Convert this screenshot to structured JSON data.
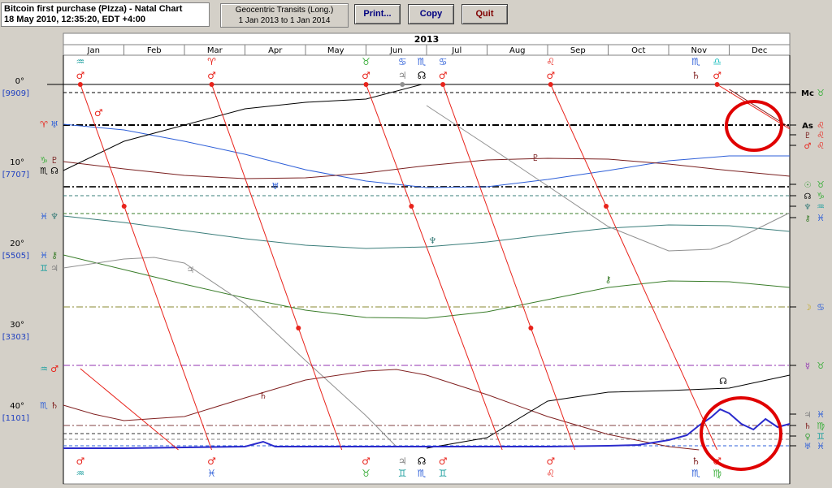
{
  "header": {
    "line1": "Bitcoin first purchase (PIzza) - Natal Chart",
    "line2": "18 May 2010, 12:35:20, EDT +4:00"
  },
  "range": {
    "line1": "Geocentric Transits (Long.)",
    "line2": "1 Jan 2013 to 1 Jan 2014"
  },
  "toolbar": {
    "print": "Print...",
    "copy": "Copy",
    "quit": "Quit"
  },
  "nav": {
    "prev": "<<",
    "next": ">>"
  },
  "colors": {
    "mars": "#e8231b",
    "saturn": "#802020",
    "jupiter": "#909090",
    "uranus": "#2e5fd8",
    "neptune": "#3a7d7a",
    "chiron": "#3a7d2a",
    "pluto": "#7a2020",
    "node": "#000000",
    "price": "#2a2acc",
    "circle": "#e00000"
  },
  "chart_data": {
    "type": "line",
    "title": "2013",
    "months": [
      "Jan",
      "Feb",
      "Mar",
      "Apr",
      "May",
      "Jun",
      "Jul",
      "Aug",
      "Sep",
      "Oct",
      "Nov",
      "Dec"
    ],
    "yticks": [
      {
        "deg": 0,
        "label": "0°",
        "price": "[9909]"
      },
      {
        "deg": 10,
        "label": "10°",
        "price": "[7707]"
      },
      {
        "deg": 20,
        "label": "20°",
        "price": "[5505]"
      },
      {
        "deg": 30,
        "label": "30°",
        "price": "[3303]"
      },
      {
        "deg": 40,
        "label": "40°",
        "price": "[1101]"
      }
    ],
    "ylim": [
      0,
      45
    ],
    "xlim": [
      0,
      12
    ],
    "glyph_sign_top": [
      {
        "x": 0.28,
        "sym": "♒",
        "color": "#20a0a0"
      },
      {
        "x": 2.45,
        "sym": "♈",
        "color": "#e8231b"
      },
      {
        "x": 5.0,
        "sym": "♉",
        "color": "#40b040"
      },
      {
        "x": 5.6,
        "sym": "♋",
        "color": "#2e5fd8"
      },
      {
        "x": 5.92,
        "sym": "♏",
        "color": "#2e5fd8"
      },
      {
        "x": 6.27,
        "sym": "♋",
        "color": "#2e5fd8"
      },
      {
        "x": 8.05,
        "sym": "♌",
        "color": "#e8231b"
      },
      {
        "x": 10.45,
        "sym": "♏",
        "color": "#2e5fd8"
      },
      {
        "x": 10.8,
        "sym": "♎",
        "color": "#20c0c0"
      }
    ],
    "glyph_planet_top": [
      {
        "x": 0.28,
        "sym": "♂",
        "color": "#e8231b"
      },
      {
        "x": 2.45,
        "sym": "♂",
        "color": "#e8231b"
      },
      {
        "x": 5.0,
        "sym": "♂",
        "color": "#e8231b"
      },
      {
        "x": 5.6,
        "sym": "♃",
        "color": "#808080"
      },
      {
        "x": 5.92,
        "sym": "☊",
        "color": "#000000"
      },
      {
        "x": 6.27,
        "sym": "♂",
        "color": "#e8231b"
      },
      {
        "x": 8.05,
        "sym": "♂",
        "color": "#e8231b"
      },
      {
        "x": 10.45,
        "sym": "♄",
        "color": "#802020"
      },
      {
        "x": 10.8,
        "sym": "♂",
        "color": "#e8231b"
      }
    ],
    "glyph_planet_bottom": [
      {
        "x": 0.28,
        "sym": "♂",
        "color": "#e8231b"
      },
      {
        "x": 2.45,
        "sym": "♂",
        "color": "#e8231b"
      },
      {
        "x": 5.0,
        "sym": "♂",
        "color": "#e8231b"
      },
      {
        "x": 5.6,
        "sym": "♃",
        "color": "#808080"
      },
      {
        "x": 5.92,
        "sym": "☊",
        "color": "#000000"
      },
      {
        "x": 6.27,
        "sym": "♂",
        "color": "#e8231b"
      },
      {
        "x": 8.05,
        "sym": "♂",
        "color": "#e8231b"
      },
      {
        "x": 10.45,
        "sym": "♄",
        "color": "#802020"
      },
      {
        "x": 10.8,
        "sym": "♂",
        "color": "#e8231b"
      }
    ],
    "glyph_sign_bottom": [
      {
        "x": 0.28,
        "sym": "♒",
        "color": "#20a0a0"
      },
      {
        "x": 2.45,
        "sym": "♓",
        "color": "#2e5fd8"
      },
      {
        "x": 5.0,
        "sym": "♉",
        "color": "#40b040"
      },
      {
        "x": 5.6,
        "sym": "♊",
        "color": "#20a0a0"
      },
      {
        "x": 5.92,
        "sym": "♏",
        "color": "#2e5fd8"
      },
      {
        "x": 6.27,
        "sym": "♊",
        "color": "#20a0a0"
      },
      {
        "x": 8.05,
        "sym": "♌",
        "color": "#e8231b"
      },
      {
        "x": 10.45,
        "sym": "♏",
        "color": "#2e5fd8"
      },
      {
        "x": 10.8,
        "sym": "♍",
        "color": "#40b040"
      }
    ],
    "left_glyphs": [
      {
        "deg": 4.9,
        "sign": "♈",
        "sc": "#e8231b",
        "planet": "♅",
        "pc": "#2e5fd8"
      },
      {
        "deg": 9.3,
        "sign": "♑",
        "sc": "#40b040",
        "planet": "♇",
        "pc": "#7a2020"
      },
      {
        "deg": 10.6,
        "sign": "♏",
        "sc": "#000000",
        "planet": "☊",
        "pc": "#000000"
      },
      {
        "deg": 16.2,
        "sign": "♓",
        "sc": "#2e5fd8",
        "planet": "♆",
        "pc": "#3a7d7a"
      },
      {
        "deg": 21.0,
        "sign": "♓",
        "sc": "#2e5fd8",
        "planet": "⚷",
        "pc": "#3a7d2a"
      },
      {
        "deg": 22.6,
        "sign": "♊",
        "sc": "#20a0a0",
        "planet": "♃",
        "pc": "#808080"
      },
      {
        "deg": 35.0,
        "sign": "♒",
        "sc": "#20a0a0",
        "planet": "♂",
        "pc": "#e8231b"
      },
      {
        "deg": 39.5,
        "sign": "♏",
        "sc": "#2e5fd8",
        "planet": "♄",
        "pc": "#802020"
      }
    ],
    "right_glyphs": [
      {
        "deg": 1.0,
        "planet": "Mc",
        "pc": "#000000",
        "sign": "♉",
        "sc": "#40b040"
      },
      {
        "deg": 5.0,
        "planet": "As",
        "pc": "#000000",
        "sign": "♌",
        "sc": "#e8231b"
      },
      {
        "deg": 6.2,
        "planet": "♇",
        "pc": "#7a2020",
        "sign": "♌",
        "sc": "#e8231b"
      },
      {
        "deg": 7.5,
        "planet": "♂",
        "pc": "#e8231b",
        "sign": "♌",
        "sc": "#e8231b"
      },
      {
        "deg": 12.3,
        "planet": "☉",
        "pc": "#40a040",
        "sign": "♉",
        "sc": "#40b040"
      },
      {
        "deg": 13.7,
        "planet": "☊",
        "pc": "#000000",
        "sign": "♑",
        "sc": "#40b040"
      },
      {
        "deg": 15.0,
        "planet": "♆",
        "pc": "#3a7d7a",
        "sign": "♒",
        "sc": "#20a0a0"
      },
      {
        "deg": 16.4,
        "planet": "⚷",
        "pc": "#3a7d2a",
        "sign": "♓",
        "sc": "#2e5fd8"
      },
      {
        "deg": 27.4,
        "planet": "☽",
        "pc": "#c0a000",
        "sign": "♋",
        "sc": "#2e5fd8"
      },
      {
        "deg": 34.6,
        "planet": "☿",
        "pc": "#9030b0",
        "sign": "♉",
        "sc": "#40b040"
      },
      {
        "deg": 40.6,
        "planet": "♃",
        "pc": "#808080",
        "sign": "♓",
        "sc": "#2e5fd8"
      },
      {
        "deg": 42.0,
        "planet": "♄",
        "pc": "#802020",
        "sign": "♍",
        "sc": "#40b040"
      },
      {
        "deg": 43.3,
        "planet": "♀",
        "pc": "#40a040",
        "sign": "♊",
        "sc": "#20a0a0"
      },
      {
        "deg": 44.5,
        "planet": "♅",
        "pc": "#2e5fd8",
        "sign": "♓",
        "sc": "#2e5fd8"
      }
    ],
    "natal_lines": [
      {
        "deg": 1.0,
        "color": "#000000",
        "style": "dash"
      },
      {
        "deg": 5.0,
        "color": "#000000",
        "style": "dashdot-bold"
      },
      {
        "deg": 12.6,
        "color": "#303030",
        "style": "dashdot-bold"
      },
      {
        "deg": 13.7,
        "color": "#3a7d7a",
        "style": "dash"
      },
      {
        "deg": 15.9,
        "color": "#3a7d2a",
        "style": "dash"
      },
      {
        "deg": 27.4,
        "color": "#8a8a30",
        "style": "dashdot"
      },
      {
        "deg": 34.6,
        "color": "#9030b0",
        "style": "dashdot"
      },
      {
        "deg": 42.0,
        "color": "#804040",
        "style": "dashdot"
      },
      {
        "deg": 43.0,
        "color": "#303030",
        "style": "dash"
      },
      {
        "deg": 43.7,
        "color": "#808080",
        "style": "dash"
      },
      {
        "deg": 44.5,
        "color": "#2e5fd8",
        "style": "dash"
      }
    ],
    "series": [
      {
        "name": "uranus",
        "color": "#2e5fd8",
        "glyph": "♅",
        "glyph_at": [
          3.5,
          12.5
        ],
        "x": [
          0,
          1,
          2,
          3,
          4,
          5,
          6,
          7,
          8,
          9,
          10,
          11,
          12
        ],
        "y": [
          4.9,
          5.6,
          7.0,
          8.6,
          10.5,
          11.9,
          12.7,
          12.6,
          11.7,
          10.6,
          9.4,
          8.8,
          8.8
        ]
      },
      {
        "name": "pluto",
        "color": "#7a2020",
        "glyph": "♇",
        "glyph_at": [
          7.8,
          9.0
        ],
        "x": [
          0,
          1,
          2,
          3,
          4,
          5,
          6,
          7,
          8,
          9,
          10,
          11,
          12
        ],
        "y": [
          9.5,
          10.4,
          11.2,
          11.6,
          11.5,
          10.9,
          10.0,
          9.3,
          9.1,
          9.2,
          9.8,
          10.6,
          11.3
        ]
      },
      {
        "name": "neptune",
        "color": "#3a7d7a",
        "glyph": "♆",
        "glyph_at": [
          6.1,
          19.2
        ],
        "x": [
          0,
          1,
          2,
          3,
          4,
          5,
          6,
          7,
          8,
          9,
          10,
          11,
          12
        ],
        "y": [
          16.2,
          17.0,
          18.0,
          19.0,
          19.8,
          20.2,
          20.0,
          19.4,
          18.5,
          17.7,
          17.3,
          17.4,
          18.1
        ]
      },
      {
        "name": "chiron",
        "color": "#3a7d2a",
        "glyph": "⚷",
        "glyph_at": [
          9.0,
          24.0
        ],
        "x": [
          0,
          1,
          2,
          3,
          4,
          5,
          6,
          7,
          8,
          9,
          10,
          11,
          12
        ],
        "y": [
          21.0,
          22.8,
          24.6,
          26.3,
          27.8,
          28.7,
          28.8,
          28.0,
          26.5,
          25.0,
          24.2,
          24.3,
          25.0
        ]
      },
      {
        "name": "jupiter",
        "color": "#909090",
        "glyph": "♃",
        "glyph_at": [
          2.1,
          22.8
        ],
        "x": [
          0,
          1,
          1.5,
          2,
          3,
          4,
          5,
          5.5,
          6,
          7,
          8,
          9,
          10,
          10.7,
          11,
          12
        ],
        "y": [
          22.6,
          21.5,
          21.3,
          22.0,
          27.0,
          34.0,
          40.8,
          44.6,
          2.6,
          7.5,
          12.5,
          17.5,
          20.5,
          20.3,
          19.5,
          15.8
        ]
      },
      {
        "name": "saturn",
        "color": "#802020",
        "glyph": "♄",
        "glyph_at": [
          3.3,
          38.3
        ],
        "x": [
          0,
          0.5,
          1,
          2,
          3,
          4,
          5,
          5.5,
          6,
          7,
          8,
          9,
          10,
          10.5,
          11,
          12
        ],
        "y": [
          39.5,
          40.6,
          41.4,
          40.9,
          38.6,
          36.4,
          35.3,
          35.1,
          35.8,
          38.2,
          40.9,
          43.1,
          44.6,
          45.0,
          0.6,
          5.3
        ]
      },
      {
        "name": "node",
        "color": "#000000",
        "glyph": "☊",
        "glyph_at": [
          10.9,
          36.5
        ],
        "x": [
          0,
          1,
          2,
          3,
          4,
          5,
          5.92,
          6,
          7,
          8,
          9,
          10,
          11,
          12
        ],
        "y": [
          10.6,
          7.0,
          5.0,
          3.0,
          2.2,
          1.8,
          0.0,
          44.8,
          43.5,
          39.0,
          37.9,
          37.7,
          37.4,
          35.8
        ]
      },
      {
        "name": "price",
        "color": "#2a2acc",
        "glyph": "",
        "glyph_at": [
          0,
          0
        ],
        "x": [
          0,
          1,
          2,
          3,
          3.3,
          3.5,
          4,
          5,
          6,
          7,
          8,
          9,
          9.5,
          10,
          10.3,
          10.5,
          10.7,
          10.85,
          11,
          11.2,
          11.4,
          11.6,
          11.8,
          12
        ],
        "y": [
          44.8,
          44.8,
          44.7,
          44.6,
          44.0,
          44.6,
          44.6,
          44.6,
          44.6,
          44.6,
          44.6,
          44.5,
          44.4,
          43.8,
          43.2,
          42.0,
          41.0,
          40.0,
          40.5,
          41.8,
          42.5,
          41.2,
          42.2,
          41.8
        ]
      }
    ],
    "mars_segments": [
      {
        "x": [
          0.28,
          1.9
        ],
        "y": [
          35.0,
          45.0
        ]
      },
      {
        "x": [
          0.28,
          2.45
        ],
        "y": [
          0.0,
          45.0
        ],
        "mid_dot": [
          0.65,
          15.0
        ],
        "mid_glyph": [
          0.42,
          3.5
        ]
      },
      {
        "x": [
          2.45,
          4.6
        ],
        "y": [
          0.0,
          45.0
        ],
        "mid_dot": [
          3.5,
          30.0
        ]
      },
      {
        "x": [
          5.0,
          7.25
        ],
        "y": [
          0.0,
          45.0
        ],
        "mid_dot": [
          3.8,
          15.0
        ]
      },
      {
        "x": [
          6.27,
          8.45
        ],
        "y": [
          0.0,
          45.0
        ],
        "mid_dot": [
          7.0,
          30.0
        ]
      },
      {
        "x": [
          8.05,
          10.8
        ],
        "y": [
          0.0,
          45.0
        ],
        "mid_dot": [
          8.8,
          15.0
        ]
      },
      {
        "x": [
          10.8,
          12.0
        ],
        "y": [
          0.0,
          5.5
        ]
      }
    ],
    "mars_top_dots": [
      0.28,
      2.45,
      5.0,
      6.27,
      8.05,
      10.8
    ],
    "highlight_circles": [
      {
        "cx": 928,
        "cy": 117,
        "rx": 34,
        "ry": 30
      },
      {
        "cx": 912,
        "cy": 496,
        "rx": 49,
        "ry": 44
      }
    ]
  }
}
